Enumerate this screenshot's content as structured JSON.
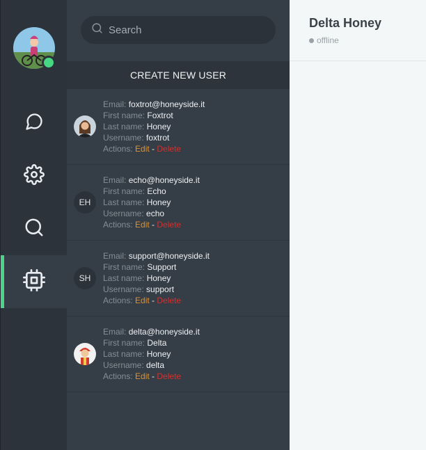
{
  "search": {
    "placeholder": "Search"
  },
  "create_button": "CREATE NEW USER",
  "labels": {
    "email": "Email:",
    "first_name": "First name:",
    "last_name": "Last name:",
    "username": "Username:",
    "actions": "Actions:",
    "edit": "Edit",
    "separator": " - ",
    "delete": "Delete"
  },
  "users": [
    {
      "initials": "",
      "email": "foxtrot@honeyside.it",
      "first_name": "Foxtrot",
      "last_name": "Honey",
      "username": "foxtrot"
    },
    {
      "initials": "EH",
      "email": "echo@honeyside.it",
      "first_name": "Echo",
      "last_name": "Honey",
      "username": "echo"
    },
    {
      "initials": "SH",
      "email": "support@honeyside.it",
      "first_name": "Support",
      "last_name": "Honey",
      "username": "support"
    },
    {
      "initials": "",
      "email": "delta@honeyside.it",
      "first_name": "Delta",
      "last_name": "Honey",
      "username": "delta"
    }
  ],
  "detail": {
    "name": "Delta Honey",
    "status": "offline"
  },
  "colors": {
    "accent": "#4ed28c",
    "online": "#46d883",
    "edit": "#e2912a",
    "delete": "#d6302d"
  },
  "icons": {
    "nav": [
      "chat-icon",
      "gear-icon",
      "search-icon",
      "chip-icon"
    ]
  }
}
